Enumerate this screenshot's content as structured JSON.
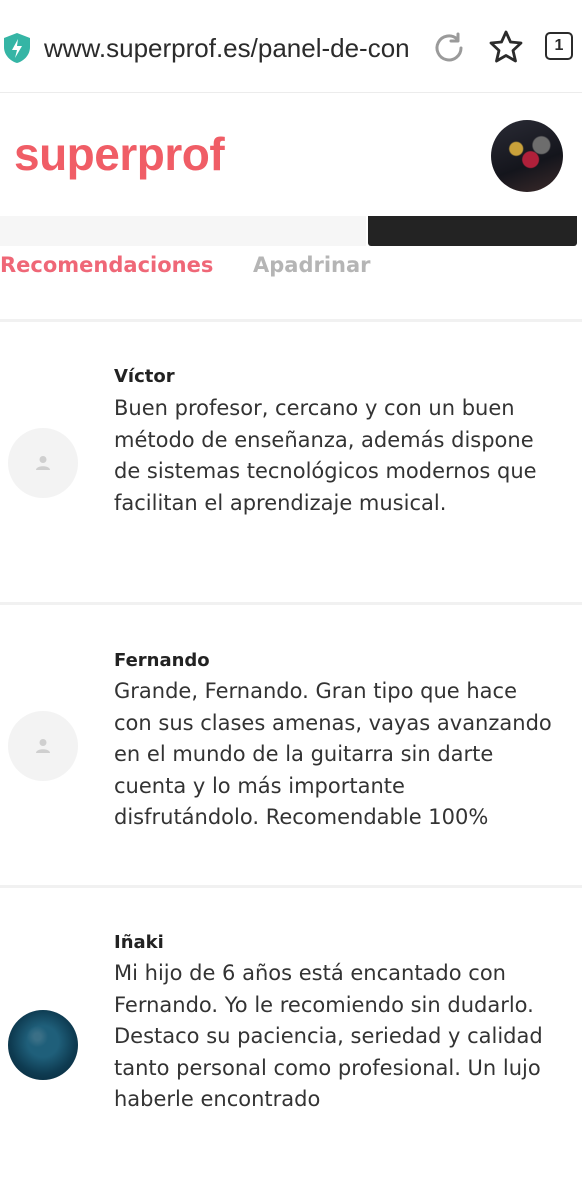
{
  "browser": {
    "url": "www.superprof.es/panel-de-control",
    "tab_count": "1",
    "icons": [
      "shield-icon",
      "reload-icon",
      "star-icon",
      "tabs-icon"
    ],
    "shield_color": "#35b5a5"
  },
  "site": {
    "logo": "superprof",
    "brand_color": "#f05d66"
  },
  "tabs": [
    {
      "label": "Recomendaciones",
      "active": true
    },
    {
      "label": "Apadrinar",
      "active": false
    }
  ],
  "reviews": [
    {
      "name": "Víctor",
      "text": "Buen profesor, cercano y con un buen método de enseñanza, además dispone de sistemas tecnológicos modernos que facilitan el aprendizaje musical.",
      "avatar": "default-user-icon"
    },
    {
      "name": "Fernando",
      "text": "Grande, Fernando. Gran tipo que hace con sus clases amenas, vayas avanzando en el mundo de la guitarra sin darte cuenta y lo más importante disfrutándolo. Recomendable 100%",
      "avatar": "default-user-icon"
    },
    {
      "name": "Iñaki",
      "text": "Mi hijo de 6 años está encantado con Fernando. Yo le recomiendo sin dudarlo. Destaco su paciencia, seriedad y calidad tanto personal como profesional. Un lujo haberle encontrado",
      "avatar": "photo"
    }
  ]
}
